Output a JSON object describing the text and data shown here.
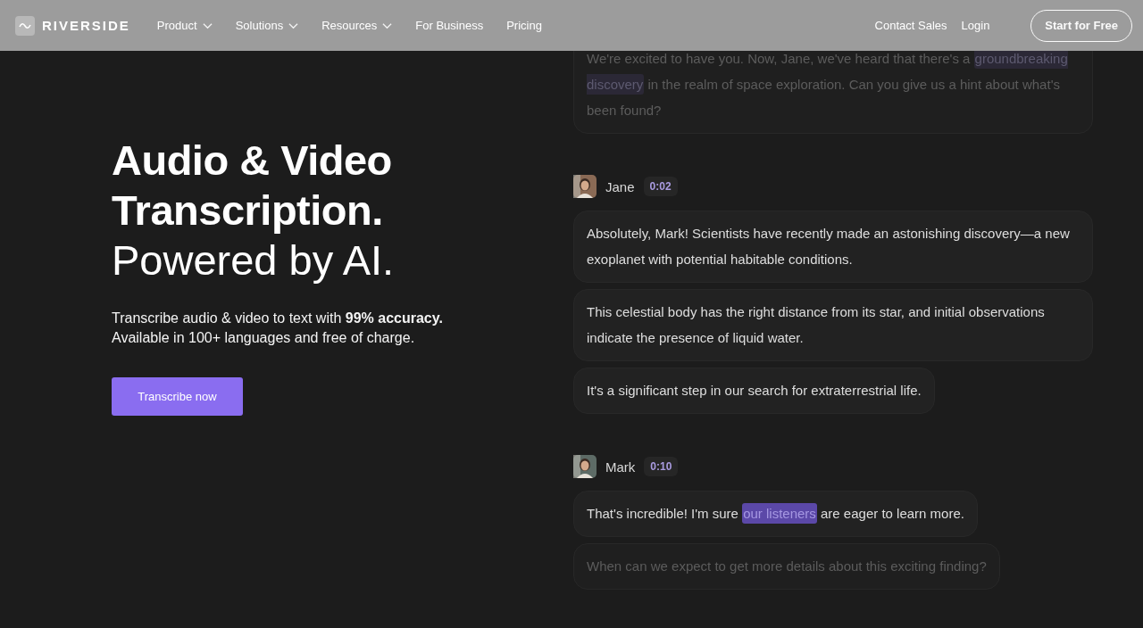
{
  "nav": {
    "logo": "RIVERSIDE",
    "menu": [
      {
        "label": "Product",
        "dropdown": true
      },
      {
        "label": "Solutions",
        "dropdown": true
      },
      {
        "label": "Resources",
        "dropdown": true
      },
      {
        "label": "For Business",
        "dropdown": false
      },
      {
        "label": "Pricing",
        "dropdown": false
      }
    ],
    "links": [
      "Contact Sales",
      "Login"
    ],
    "cta": "Start for Free"
  },
  "hero": {
    "title_lines": [
      "Audio & Video",
      "Transcription."
    ],
    "subtitle": "Powered by AI.",
    "description": [
      "Transcribe audio & video to text with **99% accuracy.**",
      "Available in 100+ languages and free of charge."
    ],
    "button": "Transcribe now"
  },
  "transcript": [
    {
      "bubbles": [
        {
          "dim": true,
          "parts": [
            {
              "text": "We're excited to have you. Now, Jane, we've heard that there's a ",
              "highlight": false
            },
            {
              "text": "groundbreaking discovery",
              "highlight": true
            },
            {
              "text": " in the realm of space exploration. Can you give us a hint about what's been found?",
              "highlight": false
            }
          ]
        }
      ]
    },
    {
      "speaker": {
        "name": "Jane",
        "time": "0:02"
      },
      "bubbles": [
        {
          "dim": false,
          "parts": [
            {
              "text": "Absolutely, Mark! Scientists have recently made an astonishing discovery—a new exoplanet with potential habitable conditions.",
              "highlight": false
            }
          ]
        },
        {
          "dim": false,
          "parts": [
            {
              "text": " This celestial body has the right distance from its star, and initial observations indicate the presence of liquid water.",
              "highlight": false
            }
          ]
        },
        {
          "dim": false,
          "parts": [
            {
              "text": " It's a significant step in our search for extraterrestrial life.",
              "highlight": false
            }
          ]
        }
      ]
    },
    {
      "speaker": {
        "name": "Mark",
        "time": "0:10"
      },
      "bubbles": [
        {
          "dim": false,
          "parts": [
            {
              "text": "That's incredible! I'm sure ",
              "highlight": false
            },
            {
              "text": "our listeners",
              "highlight": true
            },
            {
              "text": " are eager to learn more.",
              "highlight": false
            }
          ]
        },
        {
          "dim": true,
          "parts": [
            {
              "text": "When can we expect to get more details about this exciting finding?",
              "highlight": false
            }
          ]
        }
      ]
    }
  ]
}
